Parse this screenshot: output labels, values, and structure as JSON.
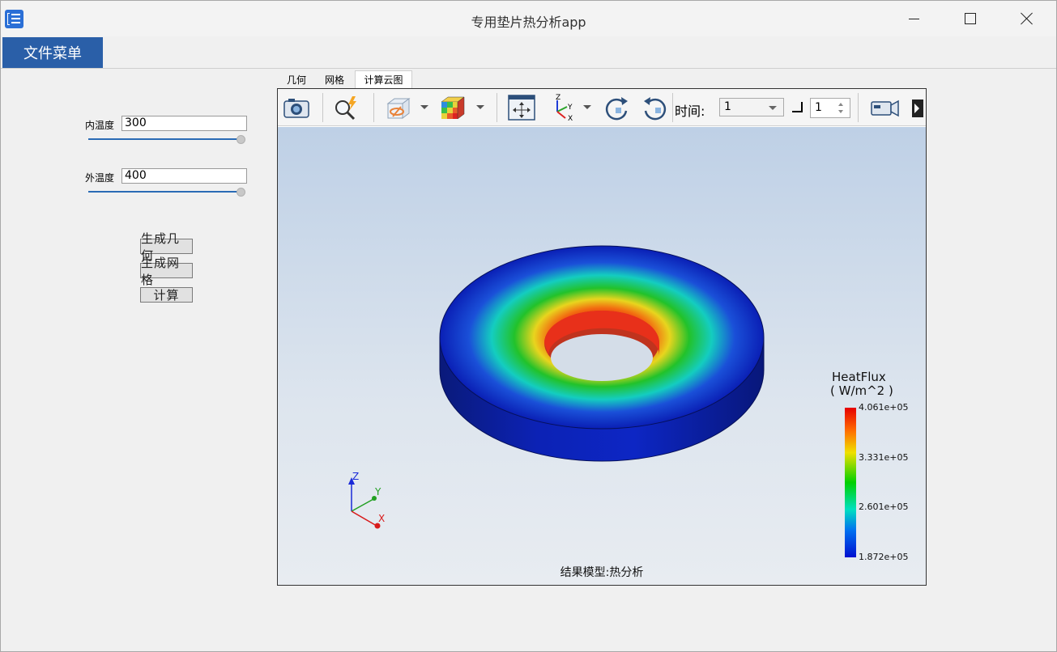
{
  "window": {
    "title": "专用垫片热分析app"
  },
  "menu": {
    "file_label": "文件菜单"
  },
  "params": {
    "inner_label": "内温度",
    "inner_value": "300",
    "outer_label": "外温度",
    "outer_value": "400"
  },
  "actions": {
    "gen_geometry": "生成几何",
    "gen_mesh": "生成网格",
    "compute": "计算"
  },
  "tabs": [
    {
      "label": "几何"
    },
    {
      "label": "网格"
    },
    {
      "label": "计算云图"
    }
  ],
  "toolbar": {
    "time_label": "时间:",
    "time_value": "1",
    "step_value": "1",
    "icons": [
      "camera-icon",
      "zoom-flash-icon",
      "display-mode-icon",
      "color-cube-icon",
      "fit-view-icon",
      "axes-orientation-icon",
      "rotate-cw-icon",
      "rotate-ccw-icon",
      "video-camera-icon",
      "more-icon"
    ]
  },
  "legend": {
    "title": "HeatFlux",
    "units": "( W/m^2 )",
    "ticks": [
      "4.061e+05",
      "3.331e+05",
      "2.601e+05",
      "1.872e+05"
    ]
  },
  "result_label": "结果模型:热分析",
  "triad": {
    "x": "X",
    "y": "Y",
    "z": "Z"
  },
  "colors": {
    "menu_accent": "#2a5fa8",
    "slider": "#2a6bb5"
  }
}
